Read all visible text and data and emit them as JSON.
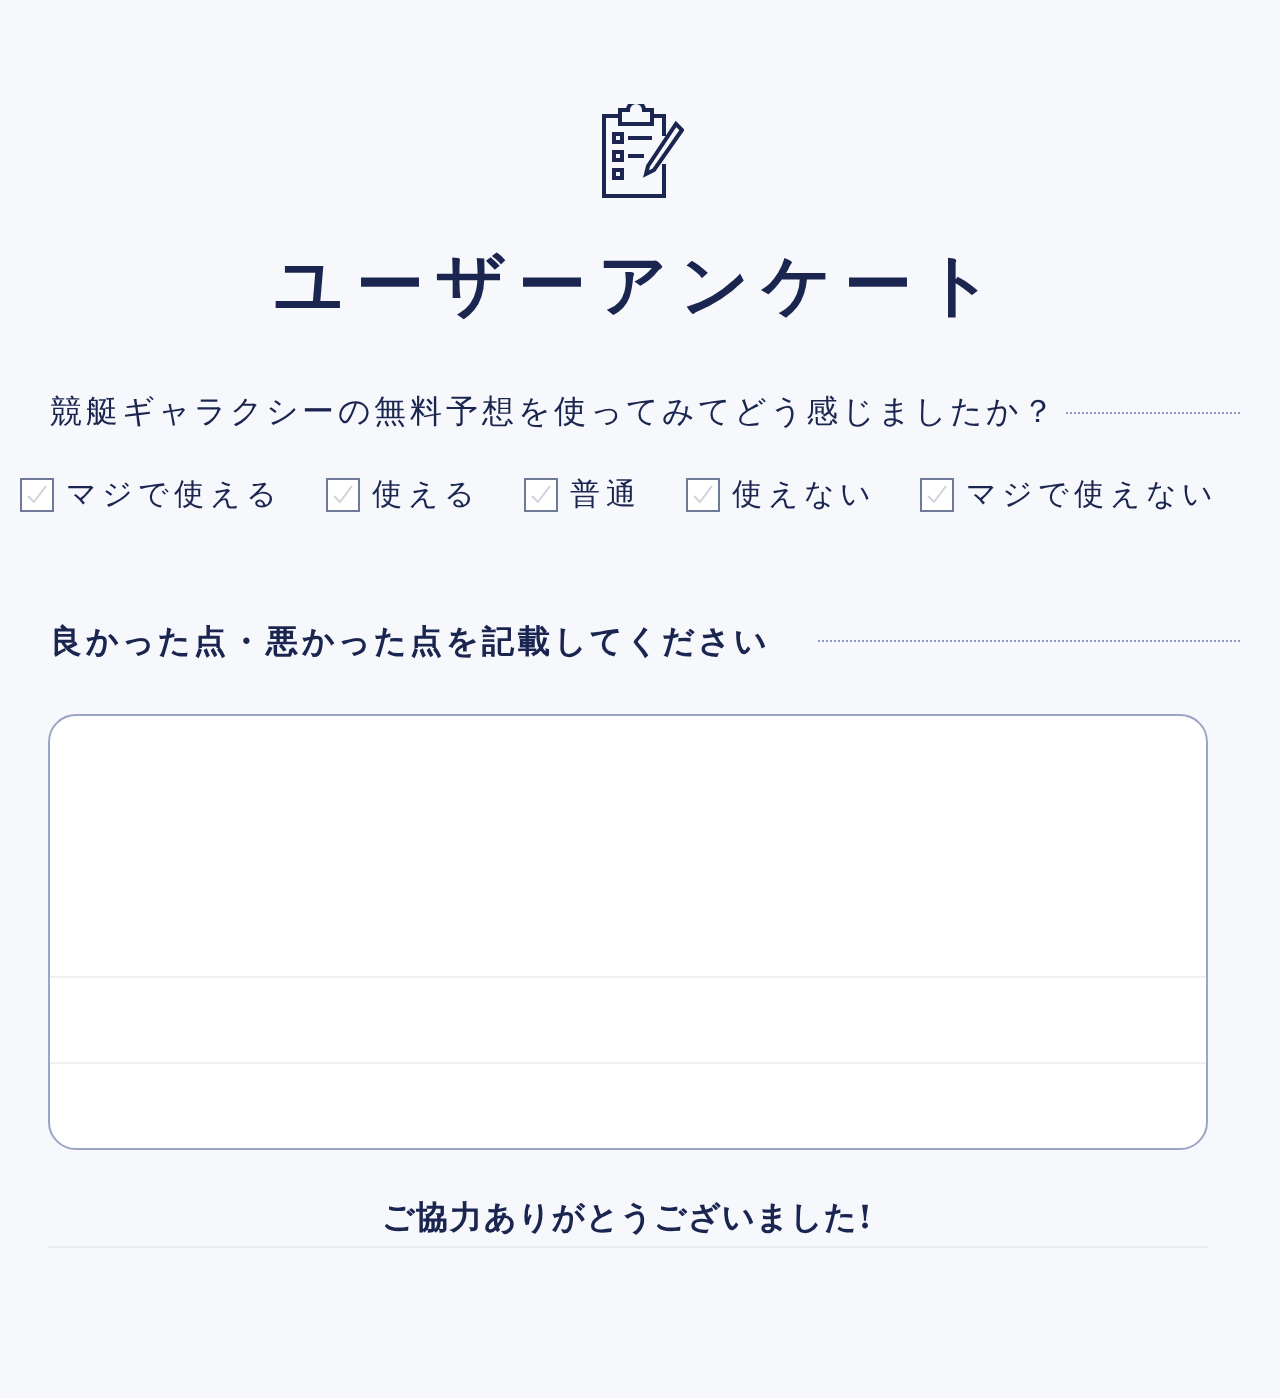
{
  "title": "ユーザーアンケート",
  "question": "競艇ギャラクシーの無料予想を使ってみてどう感じましたか？",
  "options": [
    {
      "label": "マジで使える",
      "checked": false
    },
    {
      "label": "使える",
      "checked": false
    },
    {
      "label": "普通",
      "checked": false
    },
    {
      "label": "使えない",
      "checked": false
    },
    {
      "label": "マジで使えない",
      "checked": false
    }
  ],
  "comment_label": "良かった点・悪かった点を記載してください",
  "thanks": "ご協力ありがとうございました!"
}
